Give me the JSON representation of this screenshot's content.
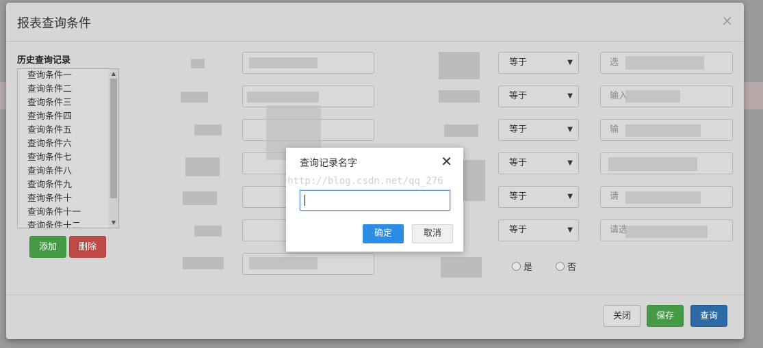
{
  "modal": {
    "title": "报表查询条件",
    "close_glyph": "×"
  },
  "history": {
    "title": "历史查询记录",
    "items": [
      "查询条件一",
      "查询条件二",
      "查询条件三",
      "查询条件四",
      "查询条件五",
      "查询条件六",
      "查询条件七",
      "查询条件八",
      "查询条件九",
      "查询条件十",
      "查询条件十一",
      "查询条件十二"
    ]
  },
  "history_buttons": {
    "add": "添加",
    "delete": "删除"
  },
  "conditions": {
    "operators": [
      "等于",
      "等于",
      "等于",
      "等于",
      "等于",
      "等于"
    ],
    "right_placeholders": [
      "选",
      "输入",
      "输",
      "",
      "请",
      "请选"
    ],
    "radio_yes": "是",
    "radio_no": "否"
  },
  "footer": {
    "close": "关闭",
    "save": "保存",
    "query": "查询"
  },
  "dialog": {
    "title": "查询记录名字",
    "close_glyph": "✕",
    "input_value": "",
    "ok": "确定",
    "cancel": "取消"
  },
  "watermark": "http://blog.csdn.net/qq_276"
}
